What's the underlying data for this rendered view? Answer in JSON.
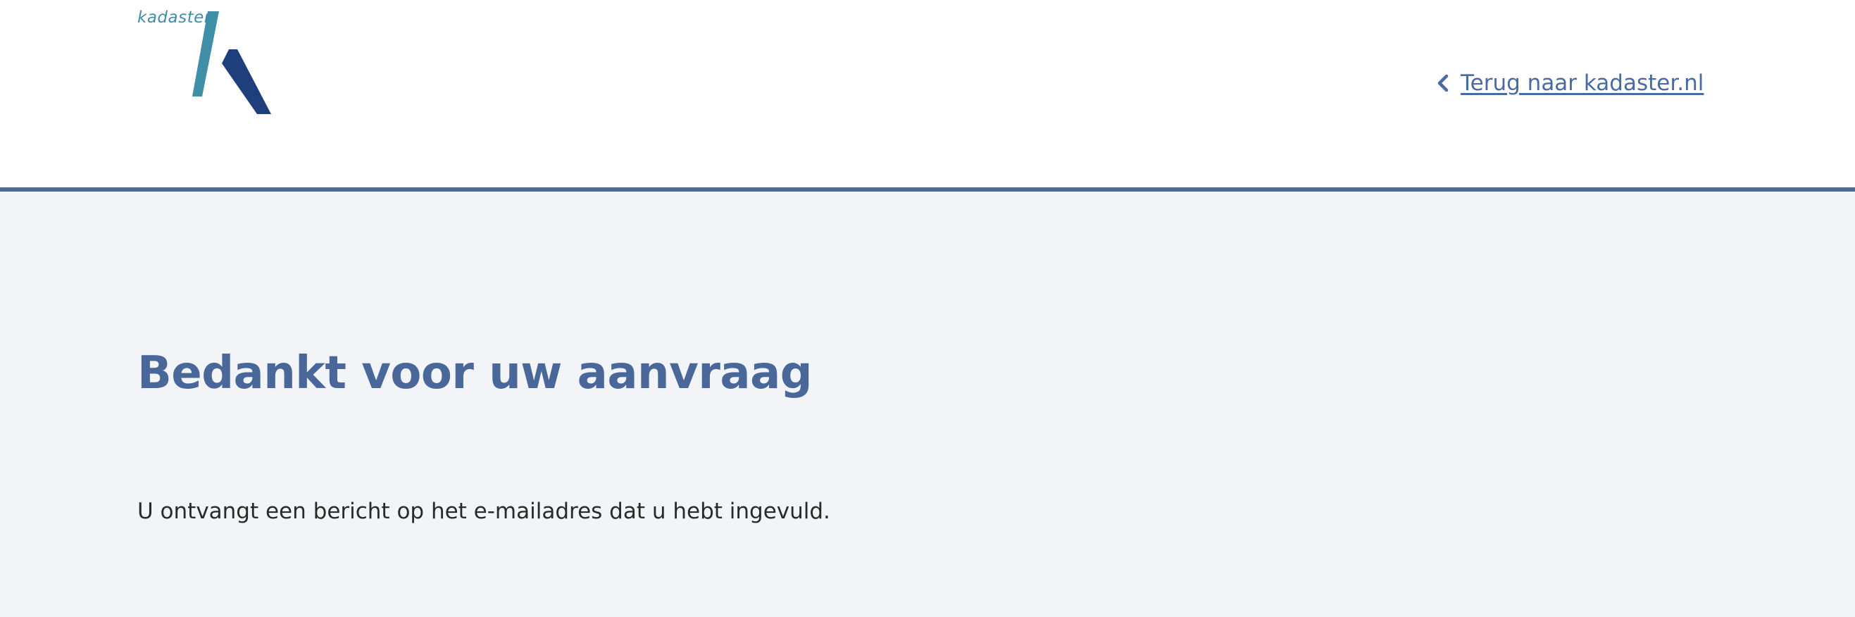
{
  "header": {
    "logo_text": "kadaster",
    "back_link_label": "Terug naar kadaster.nl",
    "logo_colors": {
      "teal": "#3f8fa6",
      "navy": "#1f3e7c"
    },
    "icons": {
      "back": "chevron-left-icon"
    }
  },
  "main": {
    "title": "Bedankt voor uw aanvraag",
    "message": "U ontvangt een bericht op het e-mailadres dat u hebt ingevuld."
  },
  "colors": {
    "accent": "#4a6898",
    "link": "#4a6aa4",
    "background": "#f2f4f8"
  }
}
